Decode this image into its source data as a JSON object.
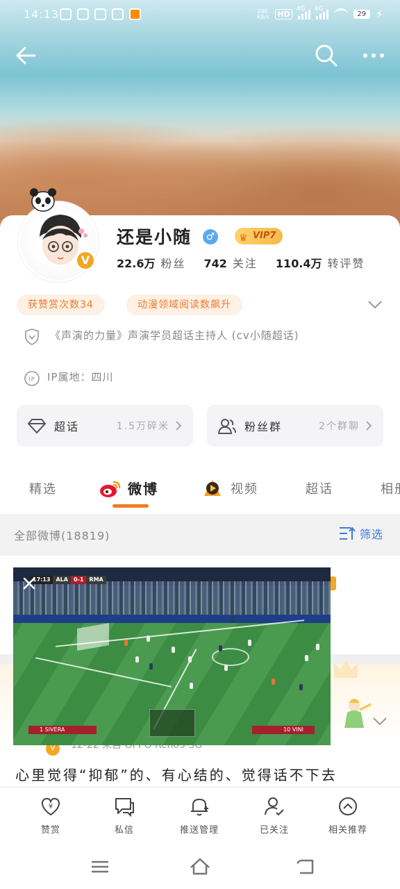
{
  "status_bar": {
    "time": "14:13",
    "net_speed_top": "296",
    "net_speed_unit": "KB/s",
    "hd": "HD",
    "sig1": "4G",
    "sig2": "4G",
    "battery": "29"
  },
  "profile": {
    "name": "还是小随",
    "vip": "VIP7",
    "stats": [
      {
        "num": "22.6万",
        "label": "粉丝"
      },
      {
        "num": "742",
        "label": "关注"
      },
      {
        "num": "110.4万",
        "label": "转评赞"
      }
    ],
    "tags": [
      "获赞赏次数34",
      "动漫领域阅读数飙升"
    ],
    "description": "《声演的力量》声演学员超话主持人 (cv小随超话)",
    "ip": "IP属地：四川"
  },
  "entries": [
    {
      "title": "超话",
      "value": "1.5万碎米"
    },
    {
      "title": "粉丝群",
      "value": "2个群聊"
    }
  ],
  "tabs": [
    "精选",
    "微博",
    "视频",
    "超话",
    "相册"
  ],
  "filter": {
    "label": "全部微博(18819)",
    "button": "筛选"
  },
  "video": {
    "time": "17:13",
    "team1": "ALA",
    "score": "0-1",
    "team2": "RMA",
    "player_left": "1 SIVERA",
    "player_right": "10 VINI"
  },
  "feed": {
    "meta": "12-22  来自 OPPO Reno9 5G",
    "text": "心里觉得“抑郁”的、有心结的、觉得话不下去"
  },
  "actions": [
    "赞赏",
    "私信",
    "推送管理",
    "已关注",
    "相关推荐"
  ],
  "colors": {
    "accent": "#f37b21",
    "link": "#3f7ad5",
    "tag_text": "#f07a2e",
    "verified": "#f3a722"
  }
}
